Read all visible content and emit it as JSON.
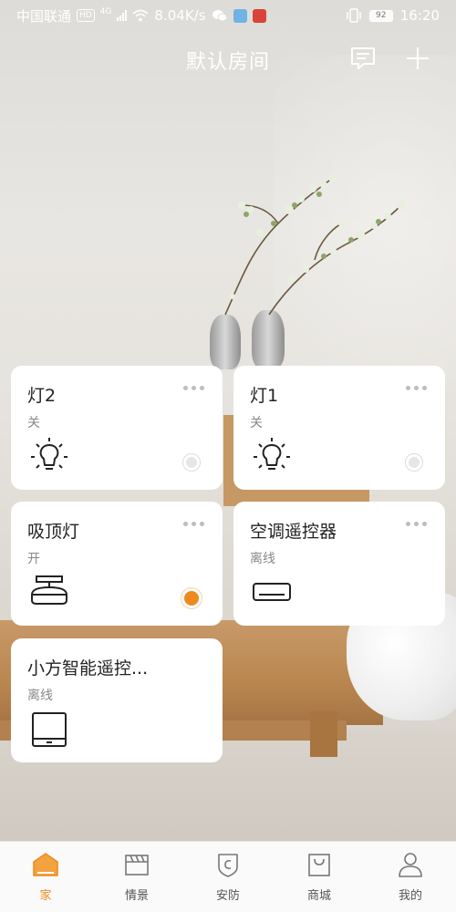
{
  "status_bar": {
    "carrier": "中国联通",
    "hd_badge": "HD",
    "network_type": "4G",
    "speed": "8.04K/s",
    "battery": "92",
    "time": "16:20"
  },
  "header": {
    "title": "默认房间",
    "message_icon": "message-icon",
    "add_icon": "plus-icon"
  },
  "devices": [
    {
      "name": "灯2",
      "status": "关",
      "icon": "bulb-icon",
      "toggle": "off"
    },
    {
      "name": "灯1",
      "status": "关",
      "icon": "bulb-icon",
      "toggle": "off"
    },
    {
      "name": "吸顶灯",
      "status": "开",
      "icon": "ceiling-light-icon",
      "toggle": "on"
    },
    {
      "name": "空调遥控器",
      "status": "离线",
      "icon": "air-conditioner-icon",
      "toggle": "none"
    },
    {
      "name": "小方智能遥控...",
      "status": "离线",
      "icon": "remote-box-icon",
      "toggle": "none"
    }
  ],
  "bottom_nav": [
    {
      "label": "家",
      "icon": "home-icon",
      "active": true
    },
    {
      "label": "情景",
      "icon": "scene-clapper-icon",
      "active": false
    },
    {
      "label": "安防",
      "icon": "shield-icon",
      "active": false
    },
    {
      "label": "商城",
      "icon": "shopping-bag-icon",
      "active": false
    },
    {
      "label": "我的",
      "icon": "person-icon",
      "active": false
    }
  ],
  "colors": {
    "accent": "#ee8a1d",
    "card_bg": "#ffffff",
    "nav_bg": "#fafafa"
  }
}
